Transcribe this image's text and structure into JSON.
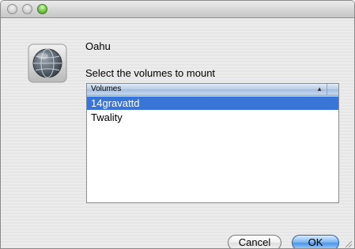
{
  "window": {
    "close_icon": "close-icon",
    "minimize_icon": "minimize-icon",
    "zoom_icon": "zoom-icon"
  },
  "dialog": {
    "icon": "network-globe-icon",
    "title": "Oahu",
    "prompt": "Select the volumes to mount"
  },
  "volume_list": {
    "column_header": "Volumes",
    "sort_indicator": "▲",
    "items": [
      {
        "label": "14gravattd",
        "selected": true
      },
      {
        "label": "Twality",
        "selected": false
      }
    ]
  },
  "buttons": {
    "cancel": "Cancel",
    "ok": "OK"
  },
  "colors": {
    "selection": "#3875d7",
    "default_button": "#4f96e6"
  }
}
